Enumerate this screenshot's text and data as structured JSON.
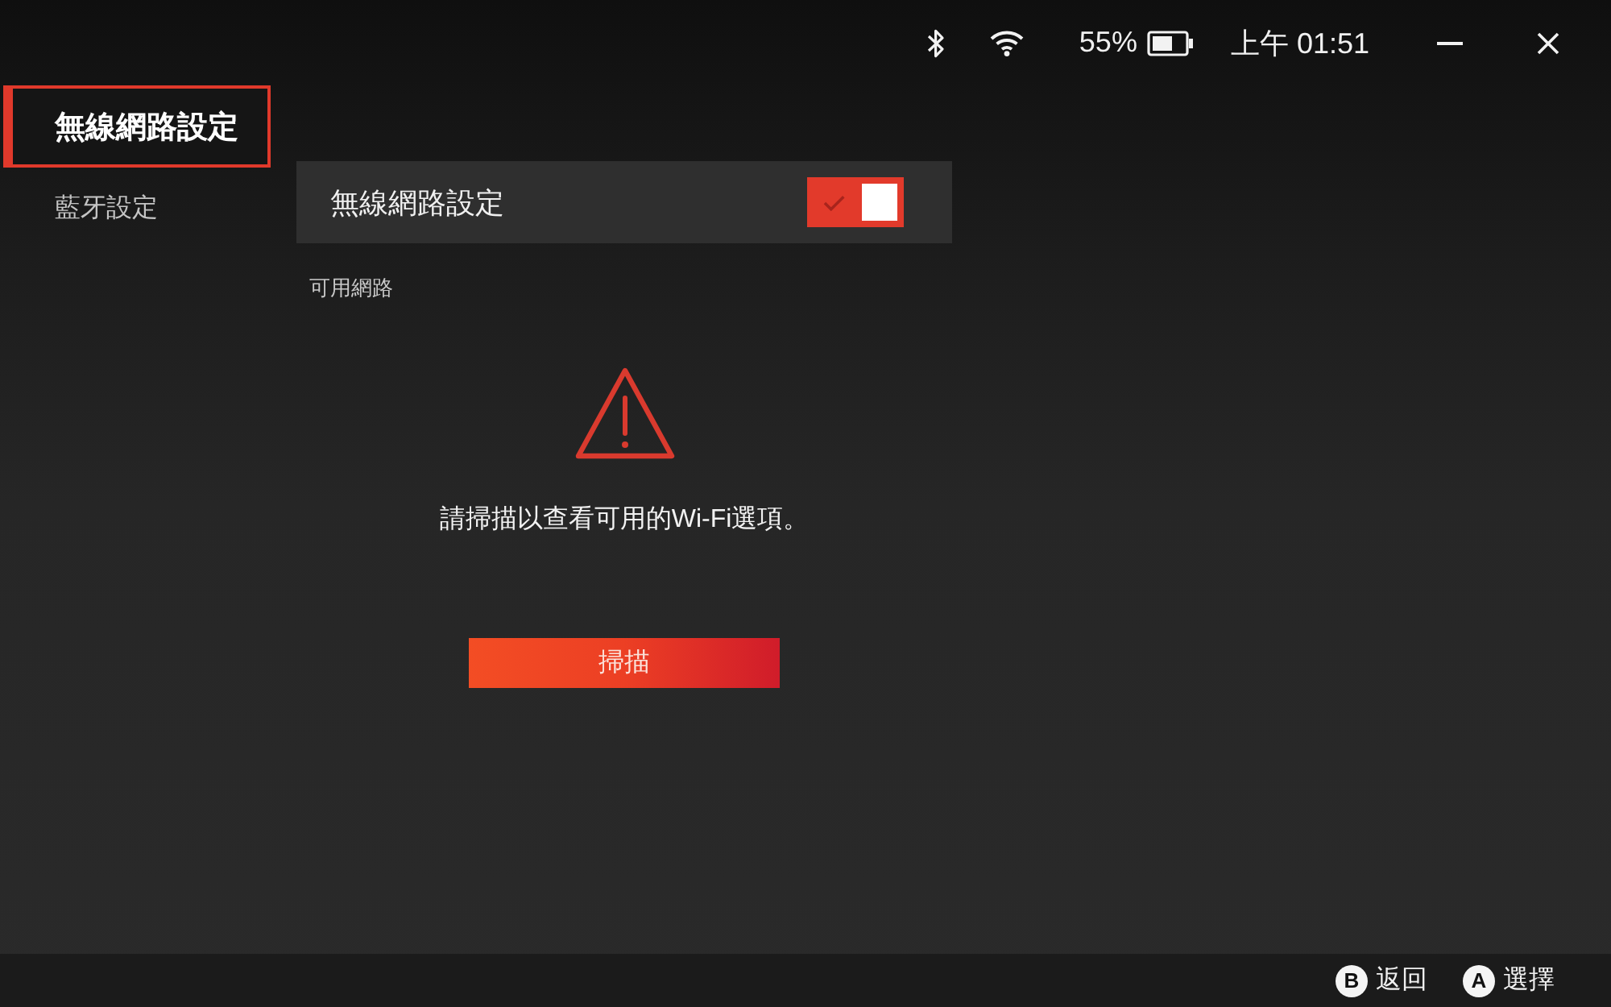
{
  "status_bar": {
    "battery_percent": "55%",
    "time": "上午 01:51"
  },
  "sidebar": {
    "items": [
      {
        "label": "無線網路設定",
        "selected": true
      },
      {
        "label": "藍牙設定",
        "selected": false
      }
    ]
  },
  "wifi_setting": {
    "label": "無線網路設定",
    "on": true
  },
  "available_networks": {
    "heading": "可用網路",
    "message": "請掃描以查看可用的Wi-Fi選項。",
    "scan_button": "掃描"
  },
  "footer": {
    "hints": [
      {
        "key": "B",
        "label": "返回"
      },
      {
        "key": "A",
        "label": "選擇"
      }
    ]
  }
}
